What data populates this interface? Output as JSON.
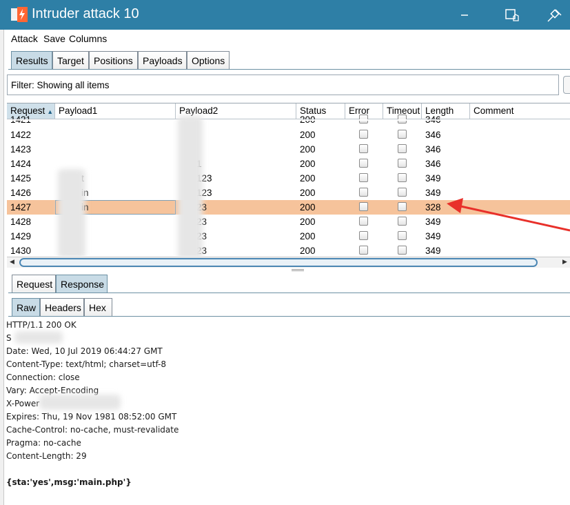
{
  "window": {
    "title": "Intruder attack 10"
  },
  "menu": [
    "Attack",
    "Save",
    "Columns"
  ],
  "tabs": [
    "Results",
    "Target",
    "Positions",
    "Payloads",
    "Options"
  ],
  "active_tab": "Results",
  "filter": {
    "text": "Filter: Showing all items"
  },
  "table": {
    "columns": [
      "Request",
      "Payload1",
      "Payload2",
      "Status",
      "Error",
      "Timeout",
      "Length",
      "Comment"
    ],
    "sorted_column": "Request",
    "partial_row": {
      "request": "1421",
      "status": "200",
      "length": "346"
    },
    "rows": [
      {
        "request": "1422",
        "payload1": "",
        "payload2": "",
        "status": "200",
        "length": "346"
      },
      {
        "request": "1423",
        "payload1": "",
        "payload2": "",
        "status": "200",
        "length": "346"
      },
      {
        "request": "1424",
        "payload1": "",
        "payload2": "1",
        "status": "200",
        "length": "346"
      },
      {
        "request": "1425",
        "payload1": "t",
        "payload2": "123",
        "status": "200",
        "length": "349"
      },
      {
        "request": "1426",
        "payload1": "in",
        "payload2": "123",
        "status": "200",
        "length": "349"
      },
      {
        "request": "1427",
        "payload1": "in",
        "payload2": "23",
        "status": "200",
        "length": "328",
        "selected": true
      },
      {
        "request": "1428",
        "payload1": "",
        "payload2": "23",
        "status": "200",
        "length": "349"
      },
      {
        "request": "1429",
        "payload1": "",
        "payload2": "23",
        "status": "200",
        "length": "349"
      },
      {
        "request": "1430",
        "payload1": "",
        "payload2": "23",
        "status": "200",
        "length": "349"
      }
    ]
  },
  "req_resp_tabs": [
    "Request",
    "Response"
  ],
  "active_req_resp_tab": "Response",
  "view_tabs": [
    "Raw",
    "Headers",
    "Hex"
  ],
  "active_view_tab": "Raw",
  "response": {
    "lines": [
      "HTTP/1.1 200 OK",
      "S",
      "Date: Wed, 10 Jul 2019 06:44:27 GMT",
      "Content-Type: text/html; charset=utf-8",
      "Connection: close",
      "Vary: Accept-Encoding",
      "X-Power",
      "Expires: Thu, 19 Nov 1981 08:52:00 GMT",
      "Cache-Control: no-cache, must-revalidate",
      "Pragma: no-cache",
      "Content-Length: 29"
    ],
    "body": "{sta:'yes',msg:'main.php'}"
  },
  "colors": {
    "titlebar": "#2e7fa6",
    "selected_row": "#f6c39b",
    "active_tab": "#c8dbe6",
    "annotation_arrow": "#e8302a"
  },
  "icons": [
    "burp-app-icon",
    "minimize-icon",
    "restore-icon",
    "pin-icon",
    "sort-ascending-icon",
    "checkbox-icon",
    "scroll-left-icon",
    "scroll-right-icon"
  ]
}
